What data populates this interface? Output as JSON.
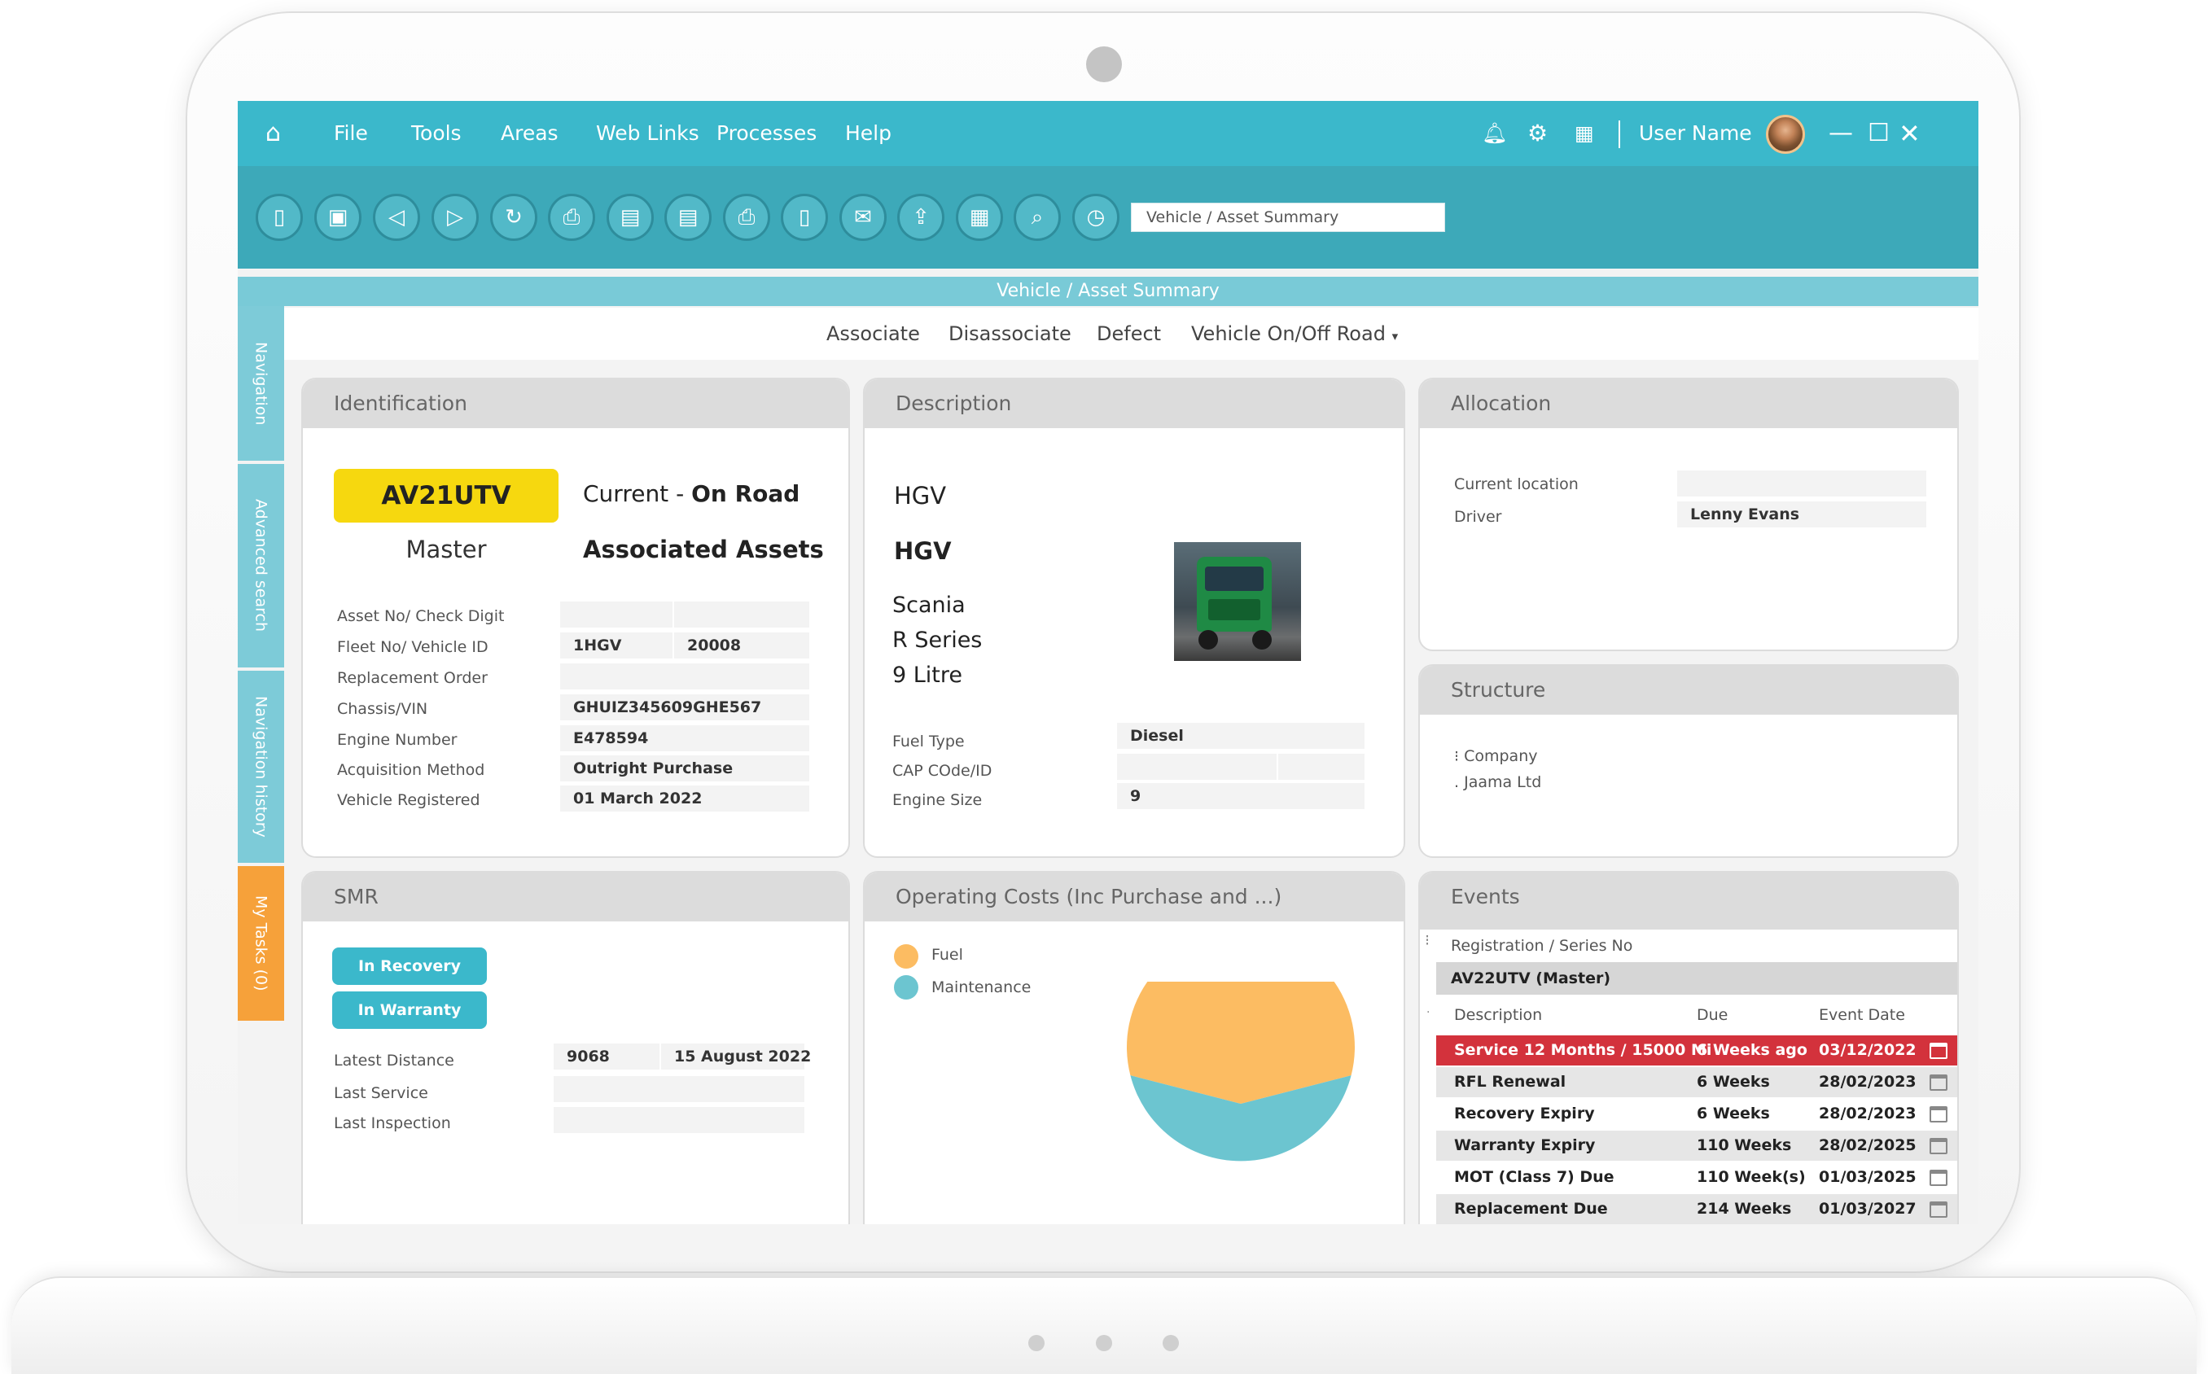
{
  "menu": {
    "items": [
      "File",
      "Tools",
      "Areas",
      "Web Links",
      "Processes",
      "Help"
    ],
    "user_name": "User Name"
  },
  "toolbar": {
    "icons": [
      "new-document-icon",
      "save-icon",
      "back-icon",
      "forward-icon",
      "refresh-icon",
      "print-icon",
      "print-preview-icon",
      "report-icon",
      "printer-icon",
      "mobile-icon",
      "email-icon",
      "export-icon",
      "calendar-icon",
      "search-icon",
      "history-icon"
    ],
    "search_value": "Vehicle / Asset Summary"
  },
  "page_title": "Vehicle / Asset Summary",
  "side_tabs": [
    "Navigation",
    "Advanced search",
    "Navigation history",
    "My Tasks (0)"
  ],
  "actions": [
    "Associate",
    "Disassociate",
    "Defect",
    "Vehicle On/Off Road"
  ],
  "identification": {
    "title": "Identification",
    "plate": "AV21UTV",
    "status_prefix": "Current - ",
    "status": "On Road",
    "master": "Master",
    "associated": "Associated Assets",
    "fields": [
      {
        "label": "Asset No/ Check Digit",
        "v1": "",
        "v2": ""
      },
      {
        "label": "Fleet No/ Vehicle ID",
        "v1": "1HGV",
        "v2": "20008"
      },
      {
        "label": "Replacement Order",
        "v1": "",
        "v2": ""
      },
      {
        "label": "Chassis/VIN",
        "v1": "GHUIZ345609GHE567",
        "v2": ""
      },
      {
        "label": "Engine Number",
        "v1": "E478594",
        "v2": ""
      },
      {
        "label": "Acquisition Method",
        "v1": "Outright Purchase",
        "v2": ""
      },
      {
        "label": "Vehicle Registered",
        "v1": "01 March 2022",
        "v2": ""
      }
    ]
  },
  "description": {
    "title": "Description",
    "lines": [
      "HGV",
      "HGV",
      "Scania",
      "R Series",
      "9 Litre"
    ],
    "fields": [
      {
        "label": "Fuel Type",
        "value": "Diesel"
      },
      {
        "label": "CAP COde/ID",
        "value": ""
      },
      {
        "label": "Engine Size",
        "value": "9"
      }
    ]
  },
  "allocation": {
    "title": "Allocation",
    "fields": [
      {
        "label": "Current location",
        "value": ""
      },
      {
        "label": "Driver",
        "value": "Lenny Evans"
      }
    ]
  },
  "structure": {
    "title": "Structure",
    "items": [
      "Company",
      "Jaama Ltd"
    ]
  },
  "smr": {
    "title": "SMR",
    "buttons": [
      "In Recovery",
      "In Warranty"
    ],
    "fields": [
      {
        "label": "Latest Distance",
        "v1": "9068",
        "v2": "15 August 2022"
      },
      {
        "label": "Last Service",
        "v1": "",
        "v2": ""
      },
      {
        "label": "Last Inspection",
        "v1": "",
        "v2": ""
      }
    ]
  },
  "operating_costs": {
    "title": "Operating Costs (Inc Purchase and ...)",
    "legend": [
      {
        "name": "Fuel",
        "color": "#fcbc62"
      },
      {
        "name": "Maintenance",
        "color": "#6cc5d0"
      }
    ]
  },
  "chart_data": {
    "type": "pie",
    "categories": [
      "Fuel",
      "Maintenance"
    ],
    "values": [
      58,
      42
    ],
    "colors": [
      "#fcbc62",
      "#6cc5d0"
    ]
  },
  "events": {
    "title": "Events",
    "group_header": "Registration / Series No",
    "group_value": "AV22UTV (Master)",
    "columns": [
      "Description",
      "Due",
      "Event Date"
    ],
    "rows": [
      {
        "desc": "Service 12 Months / 15000 Mi",
        "due": "6 Weeks ago",
        "date": "03/12/2022",
        "highlight": true
      },
      {
        "desc": "RFL Renewal",
        "due": "6 Weeks",
        "date": "28/02/2023",
        "highlight": false
      },
      {
        "desc": "Recovery Expiry",
        "due": "6 Weeks",
        "date": "28/02/2023",
        "highlight": false
      },
      {
        "desc": "Warranty Expiry",
        "due": "110 Weeks",
        "date": "28/02/2025",
        "highlight": false
      },
      {
        "desc": "MOT (Class 7) Due",
        "due": "110 Week(s)",
        "date": "01/03/2025",
        "highlight": false
      },
      {
        "desc": "Replacement Due",
        "due": "214 Weeks",
        "date": "01/03/2027",
        "highlight": false
      }
    ]
  },
  "colors": {
    "menu": "#3bb8cb",
    "toolbar": "#3da9b9",
    "accent_orange": "#f6a13a",
    "plate_yellow": "#f6d80f",
    "alert_red": "#d3323c"
  }
}
